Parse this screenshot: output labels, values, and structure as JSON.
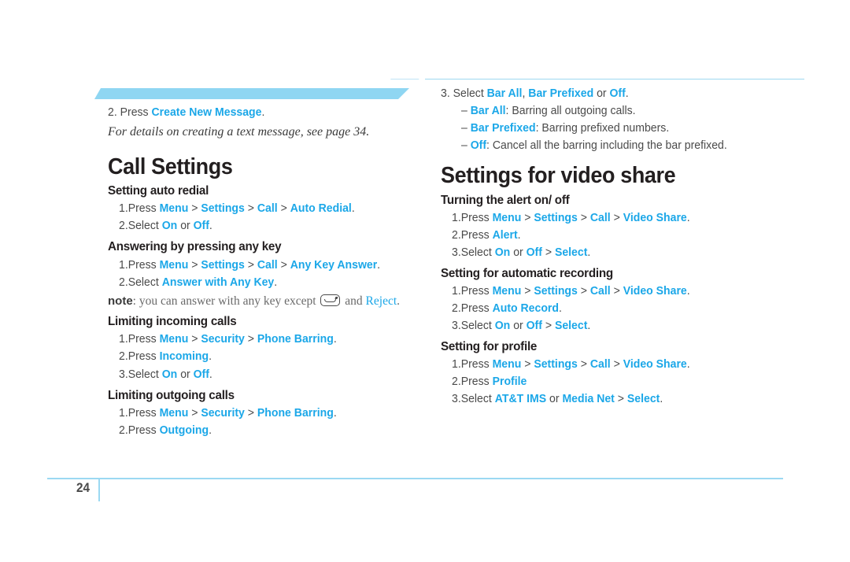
{
  "page": {
    "number": "24",
    "accent_color": "#1ba7e8",
    "band_color": "#8fd6f2",
    "rule_color": "#9bd9f2",
    "heading_color": "#231f20",
    "body_color": "#4a4a4a"
  },
  "left_column": {
    "carryover_step": {
      "num": "2.",
      "lead": "Press",
      "keyword": "Create New Message",
      "end": "."
    },
    "carryover_note": "For details on creating a text message, see page 34.",
    "title": "Call Settings",
    "sections": [
      {
        "heading": "Setting auto redial",
        "steps": [
          {
            "num": "1.",
            "parts": [
              {
                "t": "Press ",
                "k": false
              },
              {
                "t": "Menu",
                "k": true
              },
              {
                "t": " > ",
                "k": false
              },
              {
                "t": "Settings",
                "k": true
              },
              {
                "t": " > ",
                "k": false
              },
              {
                "t": "Call",
                "k": true
              },
              {
                "t": " > ",
                "k": false
              },
              {
                "t": "Auto Redial",
                "k": true
              },
              {
                "t": ".",
                "k": false
              }
            ]
          },
          {
            "num": "2.",
            "parts": [
              {
                "t": "Select ",
                "k": false
              },
              {
                "t": "On",
                "k": true
              },
              {
                "t": " or ",
                "k": false
              },
              {
                "t": "Off",
                "k": true
              },
              {
                "t": ".",
                "k": false
              }
            ]
          }
        ]
      },
      {
        "heading": "Answering by pressing any key",
        "steps": [
          {
            "num": "1.",
            "parts": [
              {
                "t": "Press ",
                "k": false
              },
              {
                "t": "Menu",
                "k": true
              },
              {
                "t": " > ",
                "k": false
              },
              {
                "t": "Settings",
                "k": true
              },
              {
                "t": " > ",
                "k": false
              },
              {
                "t": "Call",
                "k": true
              },
              {
                "t": " > ",
                "k": false
              },
              {
                "t": "Any Key Answer",
                "k": true
              },
              {
                "t": ".",
                "k": false
              }
            ]
          },
          {
            "num": "2.",
            "parts": [
              {
                "t": "Select ",
                "k": false
              },
              {
                "t": "Answer with Any Key",
                "k": true
              },
              {
                "t": ".",
                "k": false
              }
            ]
          }
        ],
        "note": {
          "label": "note",
          "before": ": you can answer with any key except ",
          "icon": "end-call-key-icon",
          "middle": " and ",
          "keyword": "Reject",
          "after": "."
        }
      },
      {
        "heading": "Limiting incoming calls",
        "steps": [
          {
            "num": "1.",
            "parts": [
              {
                "t": "Press ",
                "k": false
              },
              {
                "t": "Menu",
                "k": true
              },
              {
                "t": " > ",
                "k": false
              },
              {
                "t": "Security",
                "k": true
              },
              {
                "t": " > ",
                "k": false
              },
              {
                "t": "Phone Barring",
                "k": true
              },
              {
                "t": ".",
                "k": false
              }
            ]
          },
          {
            "num": "2.",
            "parts": [
              {
                "t": "Press ",
                "k": false
              },
              {
                "t": "Incoming",
                "k": true
              },
              {
                "t": ".",
                "k": false
              }
            ]
          },
          {
            "num": "3.",
            "parts": [
              {
                "t": "Select ",
                "k": false
              },
              {
                "t": "On",
                "k": true
              },
              {
                "t": " or ",
                "k": false
              },
              {
                "t": "Off",
                "k": true
              },
              {
                "t": ".",
                "k": false
              }
            ]
          }
        ]
      },
      {
        "heading": "Limiting outgoing calls",
        "steps": [
          {
            "num": "1.",
            "parts": [
              {
                "t": "Press ",
                "k": false
              },
              {
                "t": "Menu",
                "k": true
              },
              {
                "t": " > ",
                "k": false
              },
              {
                "t": "Security",
                "k": true
              },
              {
                "t": " > ",
                "k": false
              },
              {
                "t": "Phone Barring",
                "k": true
              },
              {
                "t": ".",
                "k": false
              }
            ]
          },
          {
            "num": "2.",
            "parts": [
              {
                "t": "Press ",
                "k": false
              },
              {
                "t": "Outgoing",
                "k": true
              },
              {
                "t": ".",
                "k": false
              }
            ]
          }
        ]
      }
    ]
  },
  "right_column": {
    "carryover_step": {
      "num": "3.",
      "parts": [
        {
          "t": "Select ",
          "k": false
        },
        {
          "t": "Bar All",
          "k": true
        },
        {
          "t": ", ",
          "k": false
        },
        {
          "t": "Bar Prefixed",
          "k": true
        },
        {
          "t": " or ",
          "k": false
        },
        {
          "t": "Off",
          "k": true
        },
        {
          "t": ".",
          "k": false
        }
      ]
    },
    "carryover_bullets": [
      {
        "dash": "–",
        "parts": [
          {
            "t": "Bar All",
            "k": true
          },
          {
            "t": ": Barring all outgoing calls.",
            "k": false
          }
        ]
      },
      {
        "dash": "–",
        "parts": [
          {
            "t": "Bar Prefixed",
            "k": true
          },
          {
            "t": ": Barring prefixed numbers.",
            "k": false
          }
        ]
      },
      {
        "dash": "–",
        "parts": [
          {
            "t": "Off",
            "k": true
          },
          {
            "t": ": Cancel all the barring including the bar prefixed.",
            "k": false
          }
        ]
      }
    ],
    "title": "Settings for video share",
    "sections": [
      {
        "heading": "Turning the alert on/ off",
        "steps": [
          {
            "num": "1.",
            "parts": [
              {
                "t": "Press ",
                "k": false
              },
              {
                "t": "Menu",
                "k": true
              },
              {
                "t": " > ",
                "k": false
              },
              {
                "t": "Settings",
                "k": true
              },
              {
                "t": " > ",
                "k": false
              },
              {
                "t": "Call",
                "k": true
              },
              {
                "t": " > ",
                "k": false
              },
              {
                "t": "Video Share",
                "k": true
              },
              {
                "t": ".",
                "k": false
              }
            ]
          },
          {
            "num": "2.",
            "parts": [
              {
                "t": "Press ",
                "k": false
              },
              {
                "t": "Alert",
                "k": true
              },
              {
                "t": ".",
                "k": false
              }
            ]
          },
          {
            "num": "3.",
            "parts": [
              {
                "t": "Select ",
                "k": false
              },
              {
                "t": "On",
                "k": true
              },
              {
                "t": " or ",
                "k": false
              },
              {
                "t": "Off",
                "k": true
              },
              {
                "t": " > ",
                "k": false
              },
              {
                "t": "Select",
                "k": true
              },
              {
                "t": ".",
                "k": false
              }
            ]
          }
        ]
      },
      {
        "heading": "Setting for automatic recording",
        "steps": [
          {
            "num": "1.",
            "parts": [
              {
                "t": "Press ",
                "k": false
              },
              {
                "t": "Menu",
                "k": true
              },
              {
                "t": " > ",
                "k": false
              },
              {
                "t": "Settings",
                "k": true
              },
              {
                "t": " > ",
                "k": false
              },
              {
                "t": "Call",
                "k": true
              },
              {
                "t": " > ",
                "k": false
              },
              {
                "t": "Video Share",
                "k": true
              },
              {
                "t": ".",
                "k": false
              }
            ]
          },
          {
            "num": "2.",
            "parts": [
              {
                "t": "Press ",
                "k": false
              },
              {
                "t": "Auto Record",
                "k": true
              },
              {
                "t": ".",
                "k": false
              }
            ]
          },
          {
            "num": "3.",
            "parts": [
              {
                "t": "Select ",
                "k": false
              },
              {
                "t": "On",
                "k": true
              },
              {
                "t": " or ",
                "k": false
              },
              {
                "t": "Off",
                "k": true
              },
              {
                "t": " > ",
                "k": false
              },
              {
                "t": "Select",
                "k": true
              },
              {
                "t": ".",
                "k": false
              }
            ]
          }
        ]
      },
      {
        "heading": "Setting for profile",
        "steps": [
          {
            "num": "1.",
            "parts": [
              {
                "t": "Press ",
                "k": false
              },
              {
                "t": "Menu",
                "k": true
              },
              {
                "t": " > ",
                "k": false
              },
              {
                "t": "Settings",
                "k": true
              },
              {
                "t": " > ",
                "k": false
              },
              {
                "t": "Call",
                "k": true
              },
              {
                "t": " > ",
                "k": false
              },
              {
                "t": "Video Share",
                "k": true
              },
              {
                "t": ".",
                "k": false
              }
            ]
          },
          {
            "num": "2.",
            "parts": [
              {
                "t": "Press ",
                "k": false
              },
              {
                "t": "Profile",
                "k": true
              }
            ]
          },
          {
            "num": "3.",
            "parts": [
              {
                "t": "Select ",
                "k": false
              },
              {
                "t": "AT&T IMS",
                "k": true
              },
              {
                "t": " or ",
                "k": false
              },
              {
                "t": "Media Net",
                "k": true
              },
              {
                "t": " > ",
                "k": false
              },
              {
                "t": "Select",
                "k": true
              },
              {
                "t": ".",
                "k": false
              }
            ]
          }
        ]
      }
    ]
  }
}
